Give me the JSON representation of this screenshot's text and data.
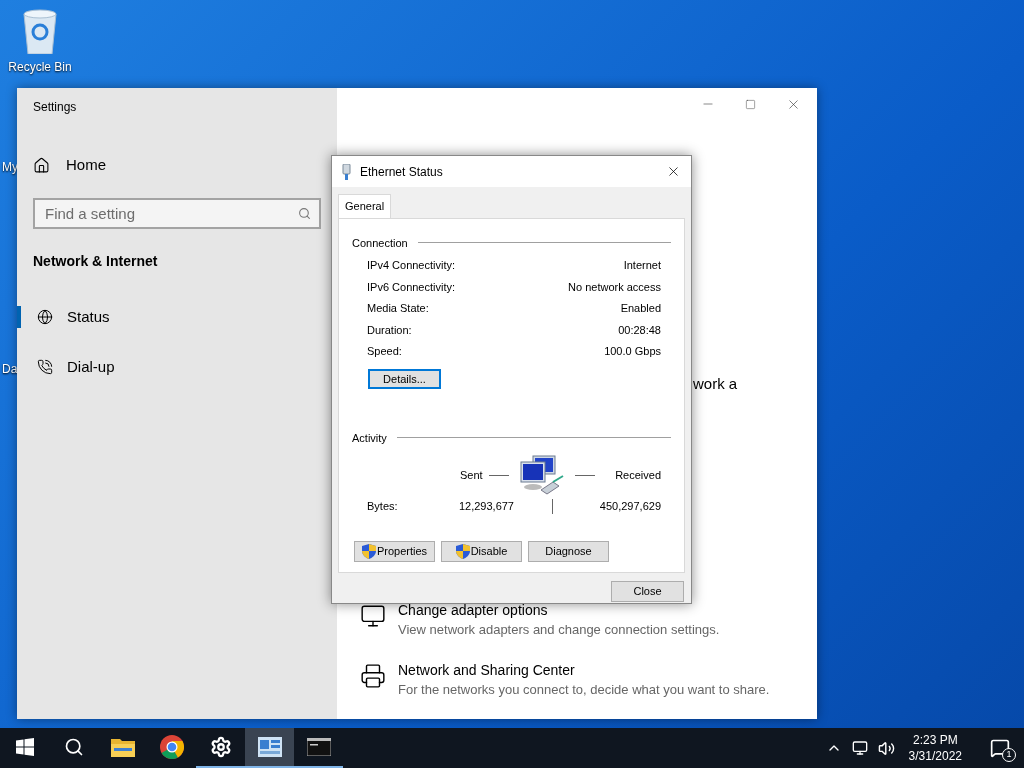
{
  "desktop_icons": [
    {
      "kind": "recycle",
      "label": "Recycle Bin"
    },
    {
      "kind": "cut",
      "label": "My"
    },
    {
      "kind": "cut",
      "label": "Da"
    }
  ],
  "settings_window": {
    "title": "Settings",
    "home": "Home",
    "search": {
      "placeholder": "Find a setting"
    },
    "section": "Network & Internet",
    "nav": [
      {
        "kind": "globe",
        "label": "Status",
        "selected": true
      },
      {
        "kind": "phone",
        "label": "Dial-up",
        "selected": false
      }
    ],
    "partial_text": "work a",
    "links": [
      {
        "kind": "monitor",
        "title": "Change adapter options",
        "description": "View network adapters and change connection settings."
      },
      {
        "kind": "printer",
        "title": "Network and Sharing Center",
        "description": "For the networks you connect to, decide what you want to share."
      }
    ]
  },
  "dialog": {
    "title": "Ethernet Status",
    "tabs": [
      {
        "label": "General",
        "selected": true
      }
    ],
    "connection": {
      "heading": "Connection",
      "rows": [
        {
          "label": "IPv4 Connectivity:",
          "value": "Internet"
        },
        {
          "label": "IPv6 Connectivity:",
          "value": "No network access"
        },
        {
          "label": "Media State:",
          "value": "Enabled"
        },
        {
          "label": "Duration:",
          "value": "00:28:48"
        },
        {
          "label": "Speed:",
          "value": "100.0 Gbps"
        }
      ]
    },
    "details_button": "Details...",
    "activity": {
      "heading": "Activity",
      "sent": "Sent",
      "received": "Received",
      "bytes_label": "Bytes:",
      "sent_value": "12,293,677",
      "received_value": "450,297,629"
    },
    "buttons": [
      {
        "label": "Properties",
        "shield": true
      },
      {
        "label": "Disable",
        "shield": true
      },
      {
        "label": "Diagnose",
        "shield": false
      }
    ],
    "close": "Close"
  },
  "taskbar": {
    "items": [
      {
        "kind": "start",
        "running": false,
        "selected": false
      },
      {
        "kind": "search",
        "running": false,
        "selected": false
      },
      {
        "kind": "folder",
        "running": false,
        "selected": false
      },
      {
        "kind": "browser",
        "running": false,
        "selected": false
      },
      {
        "kind": "gear",
        "running": true,
        "selected": false
      },
      {
        "kind": "panel",
        "running": true,
        "selected": true
      },
      {
        "kind": "terminal",
        "running": true,
        "selected": false
      }
    ],
    "time": "2:23 PM",
    "date": "3/31/2022",
    "notifications": "1"
  }
}
